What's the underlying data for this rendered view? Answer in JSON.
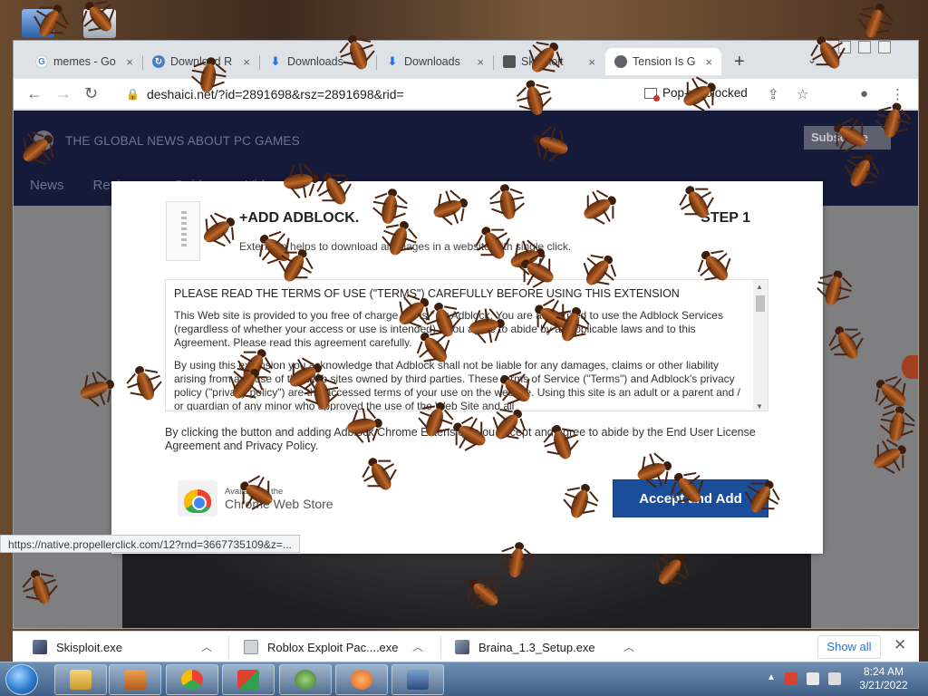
{
  "browser": {
    "tabs": [
      {
        "label": "memes - Go",
        "favicon": "google-icon",
        "active": false
      },
      {
        "label": "Download R",
        "favicon": "roblox-download-icon",
        "active": false
      },
      {
        "label": "Downloads",
        "favicon": "download-icon",
        "active": false
      },
      {
        "label": "Downloads",
        "favicon": "download-icon",
        "active": false
      },
      {
        "label": "Skisploit",
        "favicon": "skisploit-icon",
        "active": false
      },
      {
        "label": "Tension Is G",
        "favicon": "globe-icon",
        "active": true
      }
    ],
    "tab_close_glyph": "×",
    "new_tab_glyph": "+",
    "url": "deshaici.net/?id=2891698&rsz=2891698&rid=",
    "popup_blocked_label": "Pop-up blocked"
  },
  "site": {
    "tagline": "THE GLOBAL NEWS ABOUT PC GAMES",
    "subscribe_label": "Subscribe",
    "nav": [
      "News",
      "Reviews",
      "Guides",
      "Videos"
    ]
  },
  "modal": {
    "title": "+ADD ADBLOCK.",
    "step": "STEP 1",
    "subtitle": "Extension helps to download all images in a website with single click.",
    "terms_heading": "PLEASE READ THE TERMS OF USE (\"TERMS\") CAREFULLY BEFORE USING THIS EXTENSION",
    "terms_p1": "This Web site is provided to you free of charge \"as is,\" by Adblock. You are authorized to use the Adblock Services (regardless of whether your access or use is intended) if you agree to abide by all applicable laws and to this Agreement. Please read this agreement carefully.",
    "terms_p2": "By using this extension you acknowledge that Adblock shall not be liable for any damages, claims or other liability arising from any use of the Web sites owned by third parties. These terms of Service (\"Terms\") and Adblock's privacy policy (\"privacy policy\") are the accessed terms of your use on the website. Using this site is an adult or a parent and / or guardian of any minor who approved the use of the Web Site and all",
    "agree_text": "By clicking the button and adding Adblock Chrome Extension, you accept and agree to abide by the End User License Agreement and Privacy Policy.",
    "cws_small": "Available in the",
    "cws_big": "Chrome Web Store",
    "accept_label": "Accept and Add"
  },
  "status_url": "https://native.propellerclick.com/12?rnd=3667735109&z=...",
  "downloads": {
    "items": [
      {
        "name": "Skisploit.exe"
      },
      {
        "name": "Roblox Exploit Pac....exe"
      },
      {
        "name": "Braina_1.3_Setup.exe"
      }
    ],
    "show_all_label": "Show all",
    "close_glyph": "✕"
  },
  "taskbar": {
    "time": "8:24 AM",
    "date": "3/21/2022"
  },
  "colors": {
    "accept_button": "#1a4e9a",
    "site_header": "#161a3a",
    "taskbar": "#4f6f96"
  }
}
